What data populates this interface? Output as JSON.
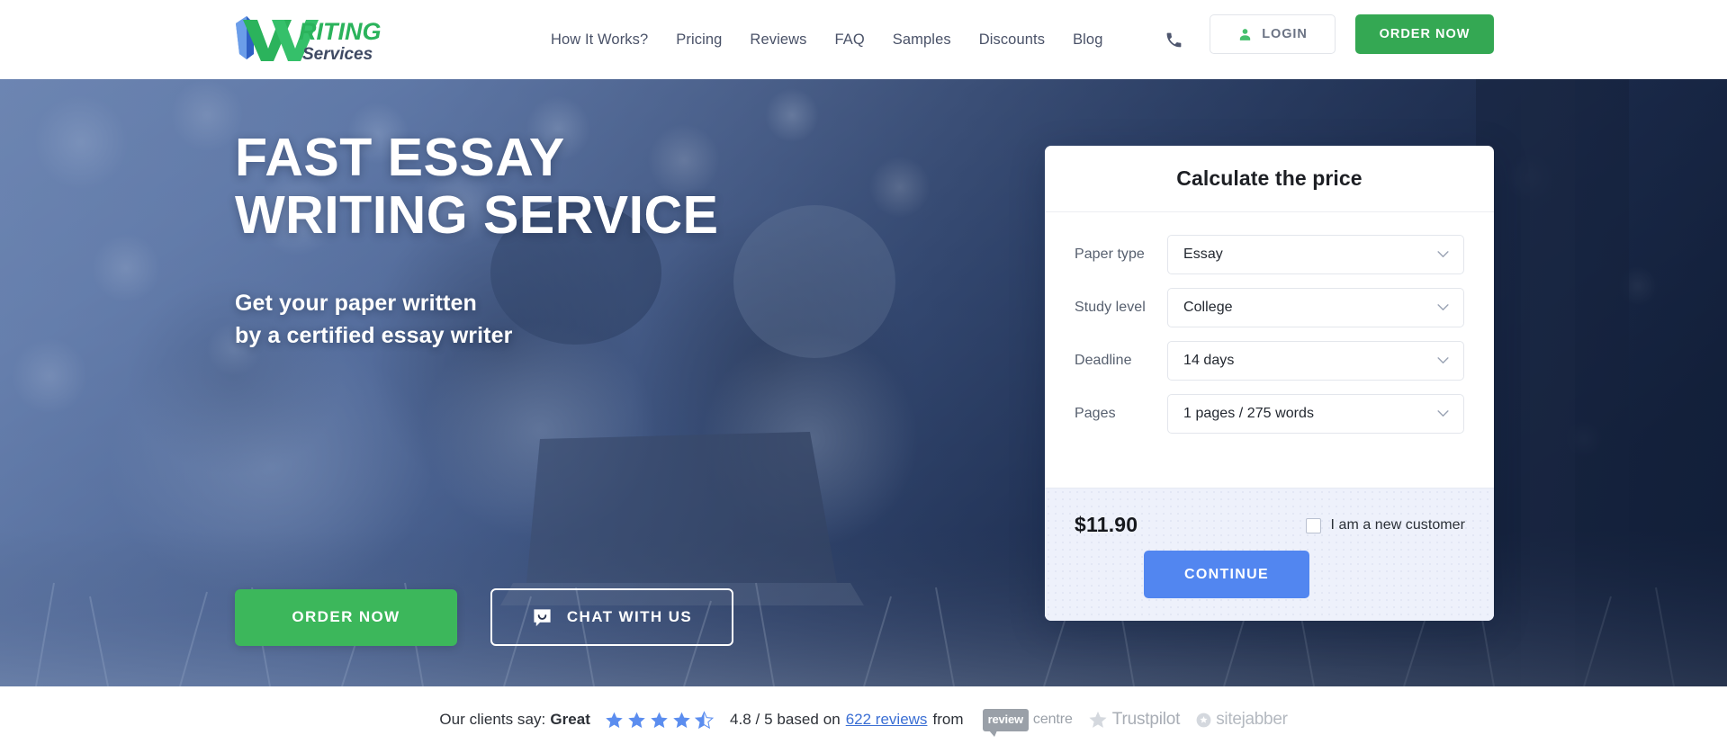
{
  "header": {
    "logo": {
      "mark": "pen-w-icon",
      "text_primary": "RITING",
      "text_secondary": "Services"
    },
    "nav": [
      {
        "label": "How It Works?"
      },
      {
        "label": "Pricing"
      },
      {
        "label": "Reviews"
      },
      {
        "label": "FAQ"
      },
      {
        "label": "Samples"
      },
      {
        "label": "Discounts"
      },
      {
        "label": "Blog"
      }
    ],
    "phone_icon": "phone-icon",
    "login": {
      "label": "LOGIN",
      "icon": "user-icon"
    },
    "order_now": {
      "label": "ORDER NOW"
    }
  },
  "hero": {
    "heading_line1": "FAST ESSAY",
    "heading_line2": "WRITING SERVICE",
    "sub_line1": "Get your paper written",
    "sub_line2": "by a certified essay writer",
    "order_button": "ORDER NOW",
    "chat_button": "CHAT WITH US",
    "chat_icon": "chat-bubble-icon"
  },
  "calculator": {
    "title": "Calculate the price",
    "fields": [
      {
        "label": "Paper type",
        "value": "Essay",
        "icon": "chevron-down-icon"
      },
      {
        "label": "Study level",
        "value": "College",
        "icon": "chevron-down-icon"
      },
      {
        "label": "Deadline",
        "value": "14 days",
        "icon": "chevron-down-icon"
      },
      {
        "label": "Pages",
        "value": "1 pages / 275 words",
        "icon": "chevron-down-icon"
      }
    ],
    "price": "$11.90",
    "new_customer_label": "I am a new customer",
    "new_customer_checked": false,
    "continue_label": "CONTINUE"
  },
  "review_bar": {
    "prefix": "Our clients say:",
    "rating_word": "Great",
    "stars_filled": 4,
    "stars_half": 1,
    "stars_total": 5,
    "score_text": "4.8 / 5 based on",
    "reviews_link": "622 reviews",
    "from_text": "from",
    "brands": [
      {
        "name": "review centre",
        "badge": "review",
        "word": "centre"
      },
      {
        "name": "Trustpilot",
        "icon": "star-icon"
      },
      {
        "name": "sitejabber",
        "icon": "sitejabber-icon"
      }
    ]
  },
  "colors": {
    "green": "#34a853",
    "hero_green": "#3cb75b",
    "blue": "#5286f0",
    "link_blue": "#3b6fd4",
    "star_blue": "#5b8def",
    "nav_text": "#4a5268",
    "card_footer": "#eef1fb"
  }
}
